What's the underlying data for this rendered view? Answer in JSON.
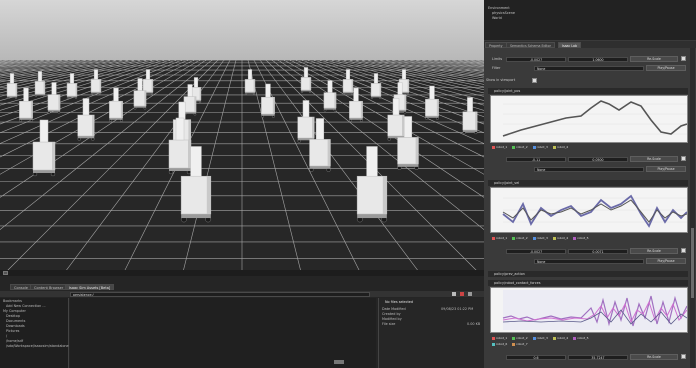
{
  "viewport": {
    "status_button": ""
  },
  "bottom": {
    "tabs": [
      "Console",
      "Content Browser",
      "Isaac Sim Assets [Beta]"
    ],
    "path": "persistence:/",
    "tree": [
      "Bookmarks",
      "Add New Connection ...",
      "My Computer",
      "Desktop",
      "Documents",
      "Downloads",
      "Pictures",
      "/",
      "/home/sdf",
      "/sda/Workspace/isaacsim/standalone"
    ],
    "details": {
      "title": "No files selected",
      "rows": [
        {
          "label": "Date Modified",
          "value": "09/08/23 01:22 PM"
        },
        {
          "label": "Created by",
          "value": ""
        },
        {
          "label": "Modified by",
          "value": ""
        },
        {
          "label": "File size",
          "value": "0.00 KB"
        }
      ]
    }
  },
  "right": {
    "scene_tree": [
      "Environment",
      "physicsScene",
      "World"
    ],
    "tabs": [
      "Property",
      "Semantics Schema Editor",
      "Isaac Lab"
    ],
    "sections": [
      {
        "limits_label": "Limits",
        "min": "-0.0027",
        "max": "1.0600",
        "rescale": "Re-Scale",
        "filter_label": "Filter",
        "filter": "None",
        "play": "Play/Pause"
      }
    ],
    "show_all": "Show in viewport",
    "plots": [
      {
        "title": "policy/joint_pos",
        "legend": [
          "robot_1",
          "robot_2",
          "robot_3",
          "robot_4"
        ],
        "min": "-0.11",
        "max": "0.0500",
        "rescale": "Re-Scale",
        "filter": "None",
        "play": "Play/Pause"
      },
      {
        "title": "policy/joint_vel",
        "legend": [
          "robot_1",
          "robot_2",
          "robot_3",
          "robot_4",
          "robot_5"
        ],
        "min": "-0.0027",
        "max": "0.0071",
        "rescale": "Re-Scale",
        "filter": "None",
        "play": "Play/Pause"
      },
      {
        "title": "policy/prev_action",
        "legend": [],
        "min": "",
        "max": "",
        "rescale": "",
        "filter": "",
        "play": ""
      },
      {
        "title": "policy/robot_contact_forces",
        "legend": [
          "robot_1",
          "robot_2",
          "robot_3",
          "robot_4",
          "robot_5",
          "robot_6",
          "robot_7"
        ],
        "min": "0.6",
        "max": "35.7247",
        "rescale": "Re-Scale",
        "filter": "None",
        "play": "Play/Pause"
      }
    ]
  }
}
